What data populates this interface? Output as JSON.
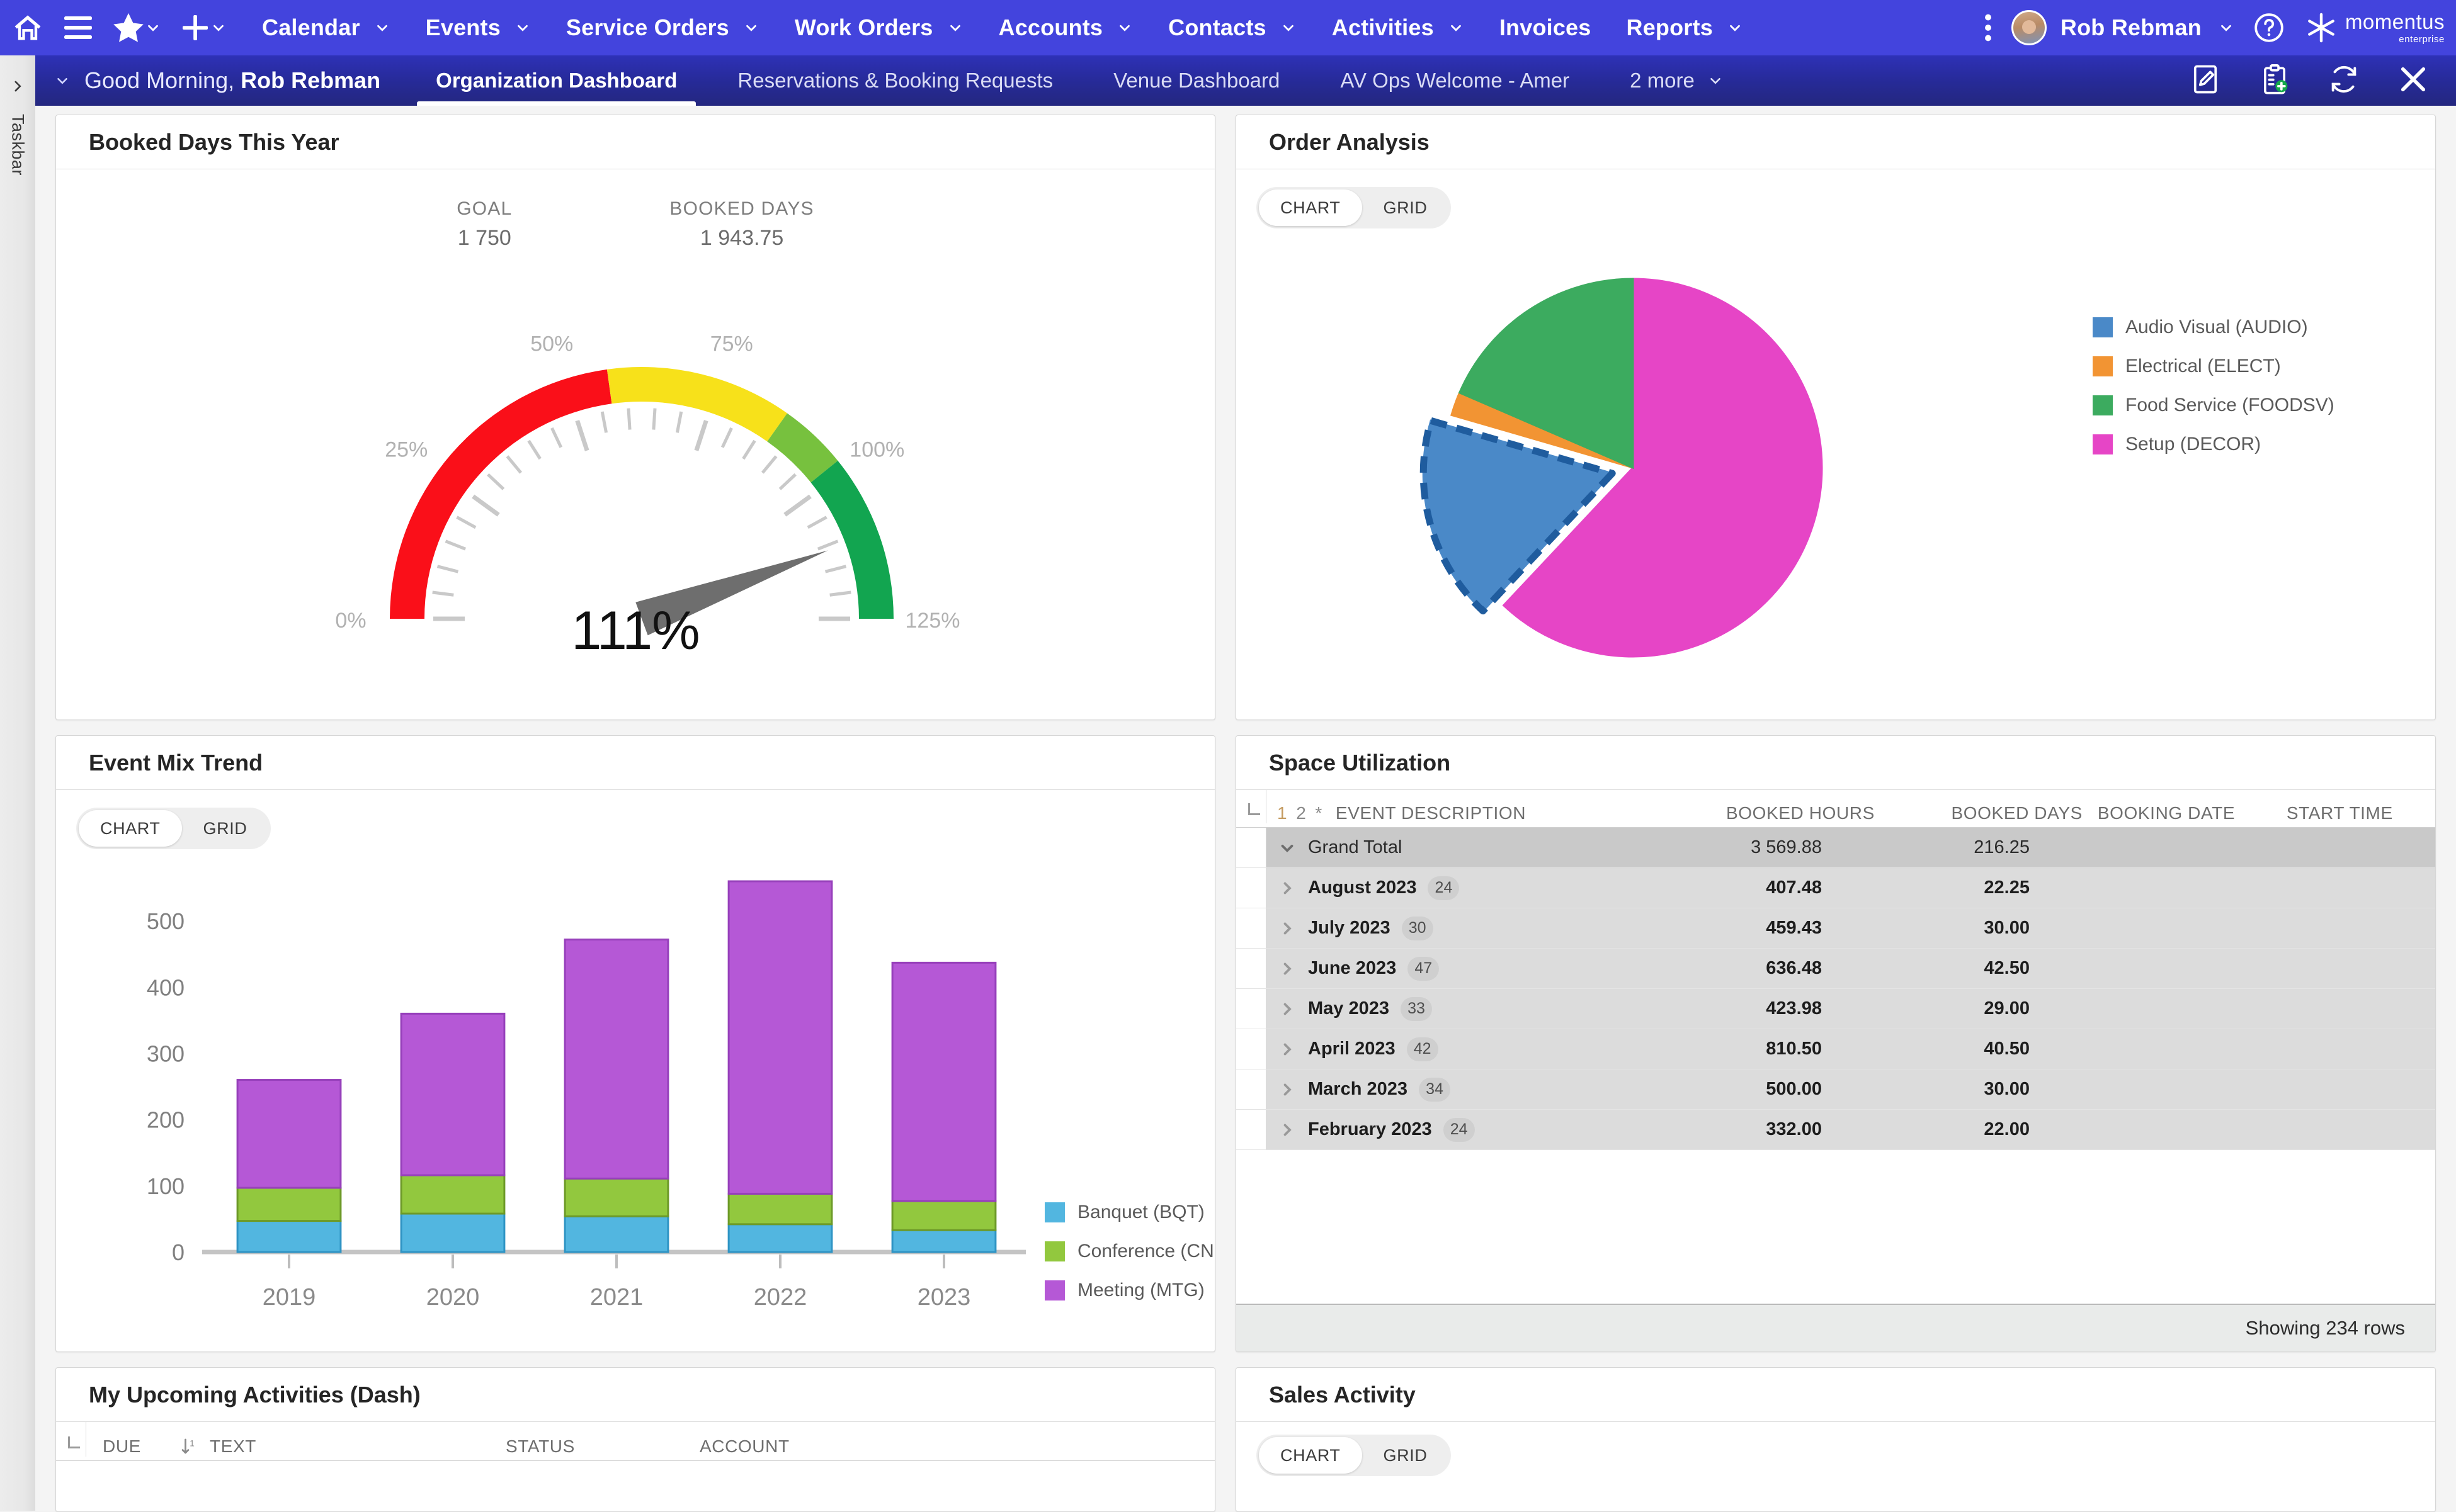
{
  "topnav": {
    "icons": [
      "home-icon",
      "hamburger-icon",
      "star-icon",
      "plus-icon"
    ],
    "menus": [
      {
        "label": "Calendar",
        "caret": true
      },
      {
        "label": "Events",
        "caret": true
      },
      {
        "label": "Service Orders",
        "caret": true
      },
      {
        "label": "Work Orders",
        "caret": true
      },
      {
        "label": "Accounts",
        "caret": true
      },
      {
        "label": "Contacts",
        "caret": true
      },
      {
        "label": "Activities",
        "caret": true
      },
      {
        "label": "Invoices",
        "caret": false
      },
      {
        "label": "Reports",
        "caret": true
      }
    ],
    "user": "Rob Rebman",
    "brand_main": "momentus",
    "brand_sub": "enterprise",
    "bg": "#4344dd"
  },
  "taskbar": {
    "label": "Taskbar"
  },
  "tabbar": {
    "greeting_prefix": "Good Morning,",
    "greeting_name": "Rob Rebman",
    "tabs": [
      {
        "label": "Organization Dashboard",
        "active": true
      },
      {
        "label": "Reservations & Booking Requests",
        "active": false
      },
      {
        "label": "Venue Dashboard",
        "active": false
      },
      {
        "label": "AV Ops Welcome - Amer",
        "active": false
      },
      {
        "label": "2 more",
        "active": false,
        "caret": true
      }
    ],
    "actions": [
      "edit-pencil-icon",
      "add-clipboard-icon",
      "refresh-icon",
      "close-icon"
    ]
  },
  "booked_days_card": {
    "title": "Booked Days This Year",
    "goal_label": "GOAL",
    "goal_value": "1 750",
    "booked_label": "BOOKED DAYS",
    "booked_value": "1 943.75",
    "gauge_center_label": "111%"
  },
  "order_analysis_card": {
    "title": "Order Analysis",
    "toggle": {
      "chart": "CHART",
      "grid": "GRID",
      "selected": "CHART"
    }
  },
  "event_mix_card": {
    "title": "Event Mix Trend",
    "toggle": {
      "chart": "CHART",
      "grid": "GRID",
      "selected": "CHART"
    }
  },
  "space_util_card": {
    "title": "Space Utilization",
    "levels": [
      "1",
      "2",
      "*"
    ],
    "columns": [
      "EVENT DESCRIPTION",
      "BOOKED HOURS",
      "BOOKED DAYS",
      "BOOKING DATE",
      "START TIME"
    ],
    "total_row": {
      "label": "Grand Total",
      "booked_hours": "3 569.88",
      "booked_days": "216.25"
    },
    "rows": [
      {
        "label": "August 2023",
        "count": "24",
        "booked_hours": "407.48",
        "booked_days": "22.25"
      },
      {
        "label": "July 2023",
        "count": "30",
        "booked_hours": "459.43",
        "booked_days": "30.00"
      },
      {
        "label": "June 2023",
        "count": "47",
        "booked_hours": "636.48",
        "booked_days": "42.50"
      },
      {
        "label": "May 2023",
        "count": "33",
        "booked_hours": "423.98",
        "booked_days": "29.00"
      },
      {
        "label": "April 2023",
        "count": "42",
        "booked_hours": "810.50",
        "booked_days": "40.50"
      },
      {
        "label": "March 2023",
        "count": "34",
        "booked_hours": "500.00",
        "booked_days": "30.00"
      },
      {
        "label": "February 2023",
        "count": "24",
        "booked_hours": "332.00",
        "booked_days": "22.00"
      }
    ],
    "footer": "Showing 234 rows"
  },
  "activities_card": {
    "title": "My Upcoming Activities (Dash)",
    "columns": [
      "DUE",
      "TEXT",
      "STATUS",
      "ACCOUNT"
    ],
    "sort_icon": "sort-descending-icon"
  },
  "sales_activity_card": {
    "title": "Sales Activity",
    "toggle": {
      "chart": "CHART",
      "grid": "GRID",
      "selected": "CHART"
    }
  },
  "chart_data": [
    {
      "type": "gauge",
      "title": "Booked Days This Year",
      "value": 111,
      "value_label": "111%",
      "unit": "%",
      "min": 0,
      "max": 125,
      "tick_labels": [
        "0%",
        "25%",
        "50%",
        "75%",
        "100%",
        "125%"
      ],
      "tick_values": [
        0,
        25,
        50,
        75,
        100,
        125
      ],
      "goal": 1750,
      "actual": 1943.75,
      "bands": [
        {
          "from": 0,
          "to": 57,
          "color": "#fa0f19"
        },
        {
          "from": 57,
          "to": 87,
          "color": "#f7e11a"
        },
        {
          "from": 87,
          "to": 98,
          "color": "#77c13e"
        },
        {
          "from": 98,
          "to": 125,
          "color": "#12a550"
        }
      ],
      "needle_color": "#6e6e6e"
    },
    {
      "type": "pie",
      "title": "Order Analysis",
      "legend_position": "right",
      "labels": [
        "Audio Visual (AUDIO)",
        "Electrical (ELECT)",
        "Food Service (FOODSV)",
        "Setup (DECOR)"
      ],
      "values": [
        17.5,
        2.0,
        18.5,
        62.0
      ],
      "colors": [
        "#4a89c8",
        "#f29433",
        "#3cab5f",
        "#e645c6"
      ],
      "exploded_index": 0,
      "selected_index": 0
    },
    {
      "type": "bar",
      "stacked": true,
      "title": "Event Mix Trend",
      "categories": [
        "2019",
        "2020",
        "2021",
        "2022",
        "2023"
      ],
      "series": [
        {
          "name": "Banquet (BQT)",
          "color": "#52b6e0",
          "values": [
            47,
            58,
            54,
            42,
            33
          ]
        },
        {
          "name": "Conference (CNF)",
          "color": "#92c83e",
          "values": [
            50,
            58,
            57,
            46,
            44
          ]
        },
        {
          "name": "Meeting (MTG)",
          "color": "#b558d6",
          "values": [
            163,
            244,
            361,
            472,
            360
          ]
        }
      ],
      "ytick_labels": [
        "0",
        "100",
        "200",
        "300",
        "400",
        "500"
      ],
      "ytick_values": [
        0,
        100,
        200,
        300,
        400,
        500
      ],
      "ylim": [
        0,
        580
      ],
      "xlabel": "",
      "ylabel": "",
      "grid": false,
      "legend_position": "right"
    },
    {
      "type": "table",
      "title": "Space Utilization",
      "columns": [
        "EVENT DESCRIPTION",
        "BOOKED HOURS",
        "BOOKED DAYS",
        "BOOKING DATE",
        "START TIME"
      ],
      "rows": [
        [
          "Grand Total",
          "3 569.88",
          "216.25",
          "",
          ""
        ],
        [
          "August 2023",
          "407.48",
          "22.25",
          "",
          ""
        ],
        [
          "July 2023",
          "459.43",
          "30.00",
          "",
          ""
        ],
        [
          "June 2023",
          "636.48",
          "42.50",
          "",
          ""
        ],
        [
          "May 2023",
          "423.98",
          "29.00",
          "",
          ""
        ],
        [
          "April 2023",
          "810.50",
          "40.50",
          "",
          ""
        ],
        [
          "March 2023",
          "500.00",
          "30.00",
          "",
          ""
        ],
        [
          "February 2023",
          "332.00",
          "22.00",
          "",
          ""
        ]
      ]
    }
  ]
}
